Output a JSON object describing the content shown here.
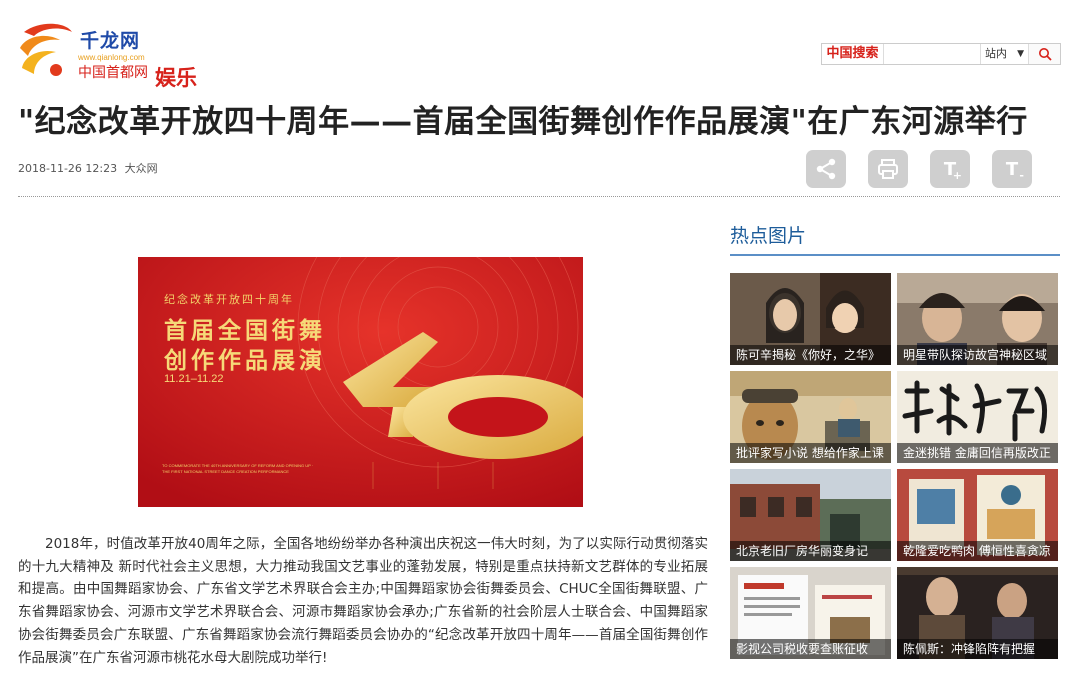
{
  "logo": {
    "name": "千龙网",
    "url": "www.qianlong.com",
    "subtitle": "中国首都网",
    "channel": "娱乐"
  },
  "search": {
    "label": "中国搜索",
    "placeholder": "",
    "scope": "站内"
  },
  "article": {
    "title": "\"纪念改革开放四十周年——首届全国街舞创作作品展演\"在广东河源举行",
    "date": "2018-11-26 12:23",
    "source": "大众网",
    "body": "2018年，时值改革开放40周年之际，全国各地纷纷举办各种演出庆祝这一伟大时刻，为了以实际行动贯彻落实的十九大精神及 新时代社会主义思想，大力推动我国文艺事业的蓬勃发展，特别是重点扶持新文艺群体的专业拓展和提高。由中国舞蹈家协会、广东省文学艺术界联合会主办;中国舞蹈家协会街舞委员会、CHUC全国街舞联盟、广东省舞蹈家协会、河源市文学艺术界联合会、河源市舞蹈家协会承办;广东省新的社会阶层人士联合会、中国舞蹈家协会街舞委员会广东联盟、广东省舞蹈家协会流行舞蹈委员会协办的“纪念改革开放四十周年——首届全国街舞创作作品展演”在广东省河源市桃花水母大剧院成功举行!"
  },
  "poster": {
    "line1": "纪念改革开放四十周年",
    "line2": "首届全国街舞",
    "line3": "创作作品展演",
    "dates": "11.21–11.22",
    "english": "TO COMMEMORATE THE 40TH ANNIVERSARY OF REFORM AND OPENING UP · THE FIRST NATIONAL STREET DANCE CREATION PERFORMANCE"
  },
  "tools": {
    "font_larger": "T",
    "font_larger_mark": "+",
    "font_smaller": "T",
    "font_smaller_mark": "-"
  },
  "sidebar": {
    "title": "热点图片",
    "items": [
      {
        "caption": "陈可辛揭秘《你好，之华》",
        "icon": "photo-two-actresses"
      },
      {
        "caption": "明星带队探访故宫神秘区域",
        "icon": "photo-actors-closeup"
      },
      {
        "caption": "批评家写小说 想给作家上课",
        "icon": "illustration-reading-man"
      },
      {
        "caption": "金迷挑错 金庸回信再版改正",
        "icon": "calligraphy-yitian"
      },
      {
        "caption": "北京老旧厂房华丽变身记",
        "icon": "photo-brick-building"
      },
      {
        "caption": "乾隆爱吃鸭肉 傅恒性喜贪凉",
        "icon": "photo-books-display"
      },
      {
        "caption": "影视公司税收要查账征收",
        "icon": "photo-tax-documents"
      },
      {
        "caption": "陈佩斯：冲锋陷阵有把握",
        "icon": "photo-stage-actors"
      }
    ]
  },
  "colors": {
    "brand_red": "#d7221b",
    "brand_blue": "#1f4aa8",
    "sidebar_blue": "#1d5c9a",
    "poster_red": "#c4141a",
    "poster_gold": "#f6d978"
  }
}
